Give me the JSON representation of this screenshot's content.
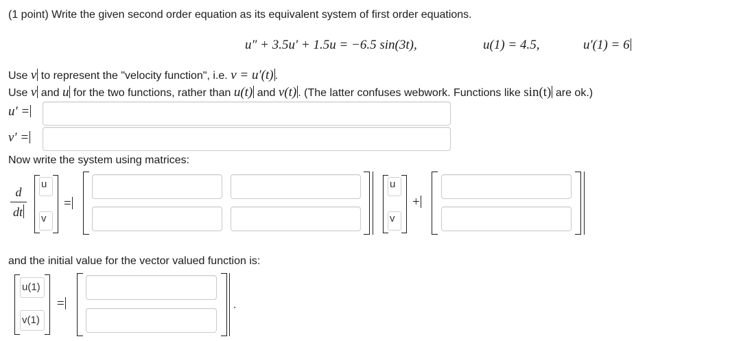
{
  "problem": {
    "intro": "(1 point) Write the given second order equation as its equivalent system of first order equations.",
    "equation": "u″ + 3.5u′ + 1.5u = −6.5 sin(3t),",
    "initial_u": "u(1) = 4.5,",
    "initial_du": "u′(1) = 6"
  },
  "instructions": {
    "line1_a": "Use",
    "line1_var": "v",
    "line1_b": "to represent the \"velocity function\", i.e.",
    "line1_eq": "v = u′(t)",
    "line1_end": ".",
    "line2_a": "Use",
    "line2_v": "v",
    "line2_and": "and",
    "line2_u": "u",
    "line2_b": "for the two functions, rather than",
    "line2_ut": "u(t)",
    "line2_and2": "and",
    "line2_vt": "v(t)",
    "line2_c": ". (The latter confuses webwork. Functions like",
    "line2_sin": "sin(t)",
    "line2_d": "are ok.)"
  },
  "system": {
    "u_prime_label": "u′ =",
    "v_prime_label": "v′ =",
    "u_prime_value": "",
    "v_prime_value": ""
  },
  "matrices": {
    "heading": "Now write the system using matrices:",
    "d_label": "d",
    "dt_label": "dt",
    "vec_top": "u",
    "vec_bottom": "v",
    "equals": "=",
    "plus": "+",
    "A": [
      "",
      "",
      "",
      ""
    ],
    "b": [
      "",
      ""
    ]
  },
  "initial": {
    "heading": "and the initial value for the vector valued function is:",
    "top": "u(1)",
    "bottom": "v(1)",
    "equals": "=",
    "period": ".",
    "values": [
      "",
      ""
    ]
  }
}
